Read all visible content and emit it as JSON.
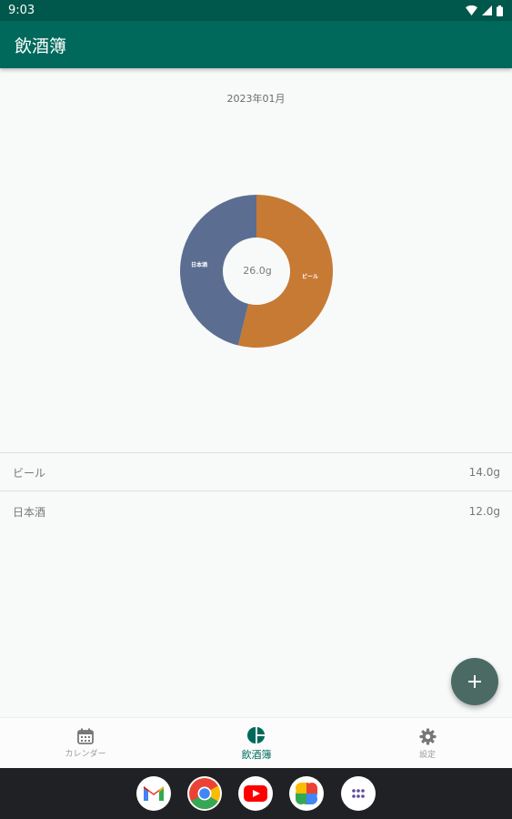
{
  "status_bar": {
    "time": "9:03"
  },
  "app_bar": {
    "title": "飲酒簿"
  },
  "summary": {
    "month": "2023年01月",
    "total": "26.0g"
  },
  "chart_data": {
    "type": "pie",
    "categories": [
      "ビール",
      "日本酒"
    ],
    "values": [
      14.0,
      12.0
    ],
    "colors": [
      "#c77a34",
      "#5b6e92"
    ],
    "title": "",
    "center_text": "26.0g"
  },
  "list": {
    "items": [
      {
        "name": "ビール",
        "amount": "14.0g"
      },
      {
        "name": "日本酒",
        "amount": "12.0g"
      }
    ]
  },
  "bottom_nav": {
    "items": [
      {
        "label": "カレンダー",
        "icon": "calendar-icon"
      },
      {
        "label": "飲酒簿",
        "icon": "pie-chart-icon"
      },
      {
        "label": "設定",
        "icon": "gear-icon"
      }
    ],
    "active_index": 1
  },
  "dock": {
    "apps": [
      "gmail-icon",
      "chrome-icon",
      "youtube-icon",
      "photos-icon",
      "app-drawer-icon"
    ]
  },
  "colors": {
    "primary": "#00695c",
    "status": "#00574b",
    "fab": "#4b6a63"
  }
}
